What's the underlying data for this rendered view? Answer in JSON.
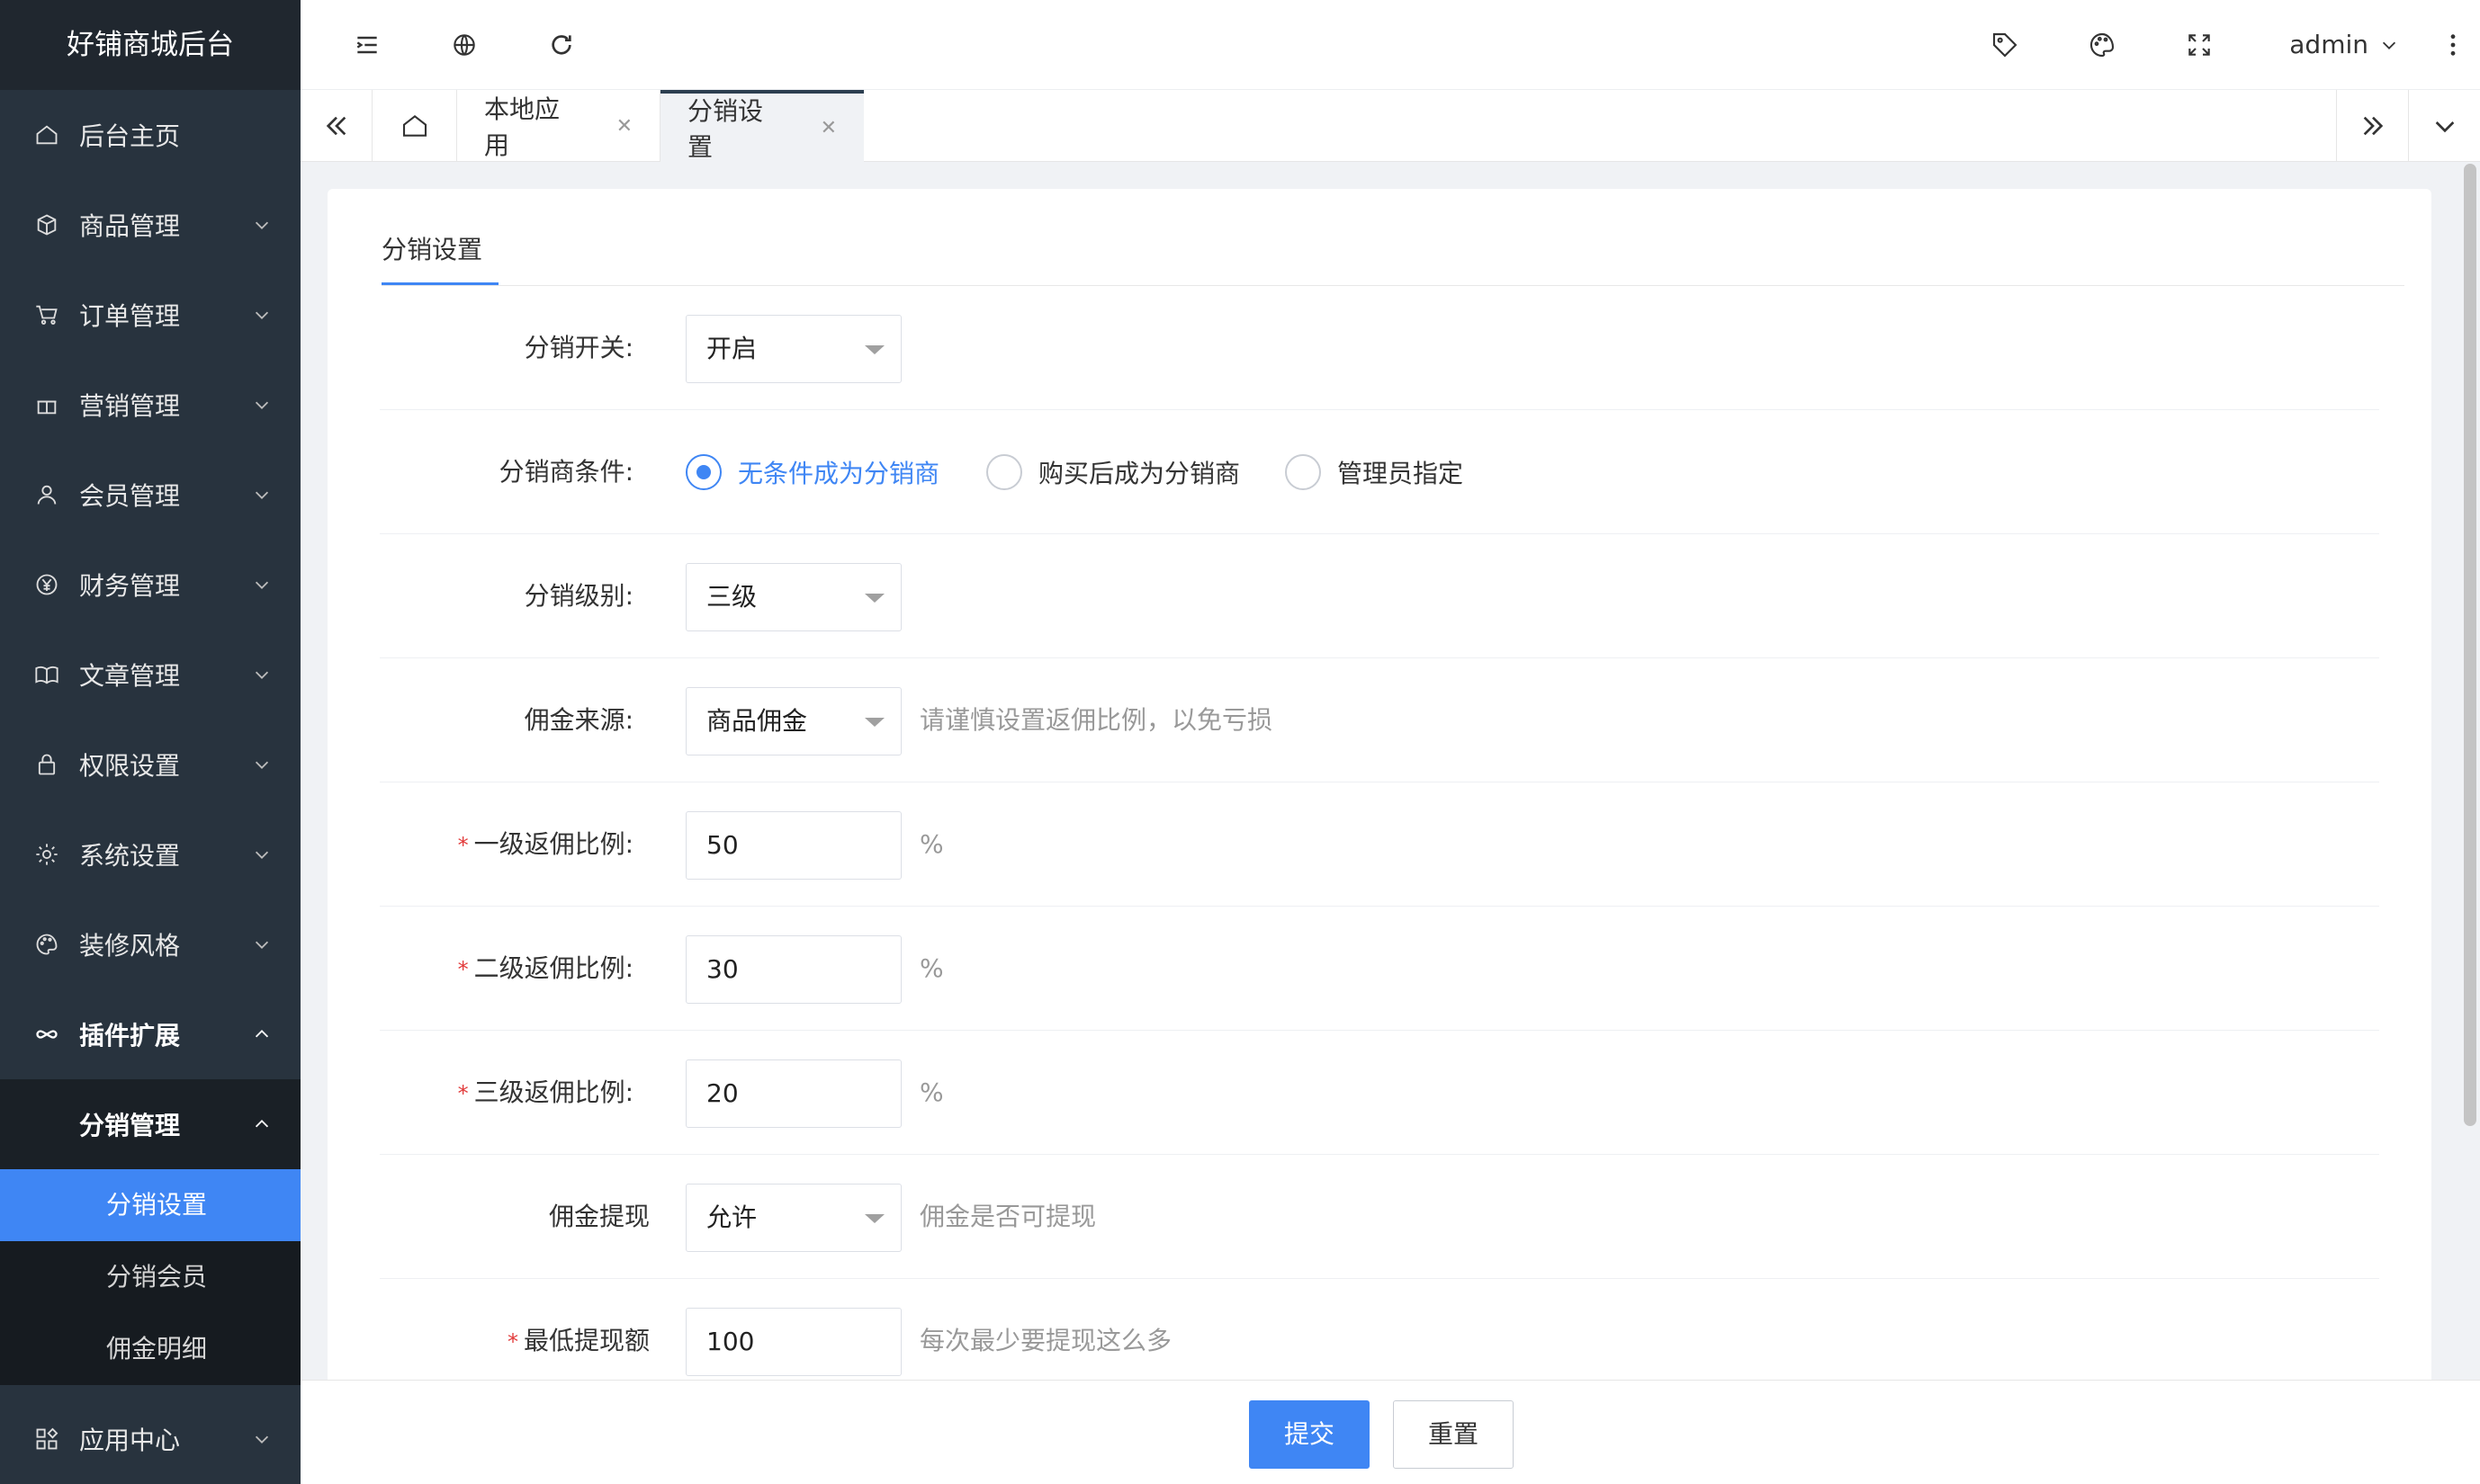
{
  "app": {
    "title": "好铺商城后台"
  },
  "sidebar": {
    "items": [
      {
        "label": "后台主页",
        "icon": "home-icon"
      },
      {
        "label": "商品管理",
        "icon": "box-icon"
      },
      {
        "label": "订单管理",
        "icon": "cart-icon"
      },
      {
        "label": "营销管理",
        "icon": "gift-icon"
      },
      {
        "label": "会员管理",
        "icon": "user-icon"
      },
      {
        "label": "财务管理",
        "icon": "yen-icon"
      },
      {
        "label": "文章管理",
        "icon": "book-icon"
      },
      {
        "label": "权限设置",
        "icon": "lock-icon"
      },
      {
        "label": "系统设置",
        "icon": "gear-icon"
      },
      {
        "label": "装修风格",
        "icon": "palette-icon"
      },
      {
        "label": "插件扩展",
        "icon": "infinity-icon"
      }
    ],
    "submenu": {
      "title": "分销管理",
      "leaves": [
        "分销设置",
        "分销会员",
        "佣金明细"
      ]
    },
    "bottom_item": {
      "label": "应用中心",
      "icon": "apps-icon"
    }
  },
  "header": {
    "user": "admin"
  },
  "tabs": [
    {
      "label": "本地应用"
    },
    {
      "label": "分销设置"
    }
  ],
  "content": {
    "tab": "分销设置",
    "fields": {
      "switch": {
        "label": "分销开关:",
        "value": "开启"
      },
      "condition": {
        "label": "分销商条件:",
        "options": [
          "无条件成为分销商",
          "购买后成为分销商",
          "管理员指定"
        ],
        "selected": "无条件成为分销商"
      },
      "level": {
        "label": "分销级别:",
        "value": "三级"
      },
      "source": {
        "label": "佣金来源:",
        "value": "商品佣金",
        "hint": "请谨慎设置返佣比例，以免亏损"
      },
      "rate1": {
        "label": "一级返佣比例:",
        "value": "50",
        "unit": "%"
      },
      "rate2": {
        "label": "二级返佣比例:",
        "value": "30",
        "unit": "%"
      },
      "rate3": {
        "label": "三级返佣比例:",
        "value": "20",
        "unit": "%"
      },
      "withdraw": {
        "label": "佣金提现",
        "value": "允许",
        "hint": "佣金是否可提现"
      },
      "min_withdraw": {
        "label": "最低提现额",
        "value": "100",
        "hint": "每次最少要提现这么多"
      }
    },
    "required_mark": "*"
  },
  "footer": {
    "submit": "提交",
    "reset": "重置"
  },
  "colors": {
    "accent": "#3f86f4",
    "sidebar": "#28333e",
    "required": "#e23b3b"
  }
}
